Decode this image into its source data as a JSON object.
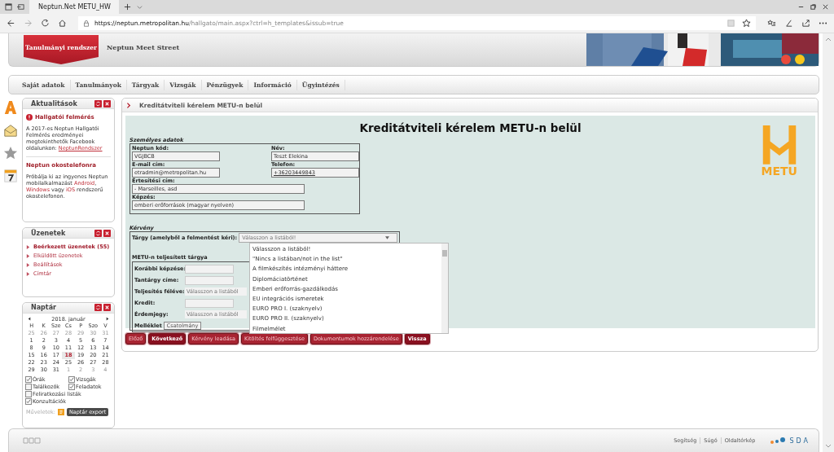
{
  "browser": {
    "tab_title": "Neptun.Net METU_HW",
    "url_host": "https://neptun.metropolitan.hu",
    "url_path": "/hallgato/main.aspx?ctrl=h_templates&issub=true"
  },
  "header": {
    "system_tab": "Tanulmányi rendszer",
    "site_title": "Neptun Meet Street"
  },
  "menu": [
    {
      "label": "Saját adatok"
    },
    {
      "label": "Tanulmányok"
    },
    {
      "label": "Tárgyak"
    },
    {
      "label": "Vizsgák"
    },
    {
      "label": "Pénzügyek"
    },
    {
      "label": "Információ"
    },
    {
      "label": "Ügyintézés"
    }
  ],
  "news": {
    "title": "Aktualitások",
    "items": [
      {
        "title": "Hallgatói felmérés",
        "alert": true,
        "parts": [
          {
            "kind": "text",
            "text": "A 2017-es Neptun Hallgatói Felmérés eredményei megtekinthetők Facebook oldalunkon: "
          },
          {
            "kind": "link",
            "text": "NeptunRendszer"
          }
        ]
      },
      {
        "title": "Neptun okostelefonra",
        "alert": false,
        "parts": [
          {
            "kind": "text",
            "text": "Próbálja ki az ingyenes Neptun mobilalkalmazást "
          },
          {
            "kind": "link",
            "text": "Android"
          },
          {
            "kind": "text",
            "text": ", "
          },
          {
            "kind": "link",
            "text": "Windows"
          },
          {
            "kind": "text",
            "text": " vagy "
          },
          {
            "kind": "link",
            "text": "iOS"
          },
          {
            "kind": "text",
            "text": " rendszerű okostelefonon."
          }
        ]
      }
    ]
  },
  "messages": {
    "title": "Üzenetek",
    "items": [
      {
        "label": "Beérkezett üzenetek (55)",
        "unread": true
      },
      {
        "label": "Elküldött üzenetek",
        "unread": false
      },
      {
        "label": "Beállítások",
        "unread": false
      },
      {
        "label": "Címtár",
        "unread": false
      }
    ]
  },
  "calendar": {
    "title": "Naptár",
    "month": "2018. január",
    "weekdays": [
      "H",
      "K",
      "Sze",
      "Cs",
      "P",
      "Szo",
      "V"
    ],
    "weeks": [
      [
        {
          "day": "25",
          "other_month": true,
          "today": false
        },
        {
          "day": "26",
          "other_month": true,
          "today": false
        },
        {
          "day": "27",
          "other_month": true,
          "today": false
        },
        {
          "day": "28",
          "other_month": true,
          "today": false
        },
        {
          "day": "29",
          "other_month": true,
          "today": false
        },
        {
          "day": "30",
          "other_month": true,
          "today": false
        },
        {
          "day": "31",
          "other_month": true,
          "today": false
        }
      ],
      [
        {
          "day": "1",
          "other_month": false,
          "today": false
        },
        {
          "day": "2",
          "other_month": false,
          "today": false
        },
        {
          "day": "3",
          "other_month": false,
          "today": false
        },
        {
          "day": "4",
          "other_month": false,
          "today": false
        },
        {
          "day": "5",
          "other_month": false,
          "today": false
        },
        {
          "day": "6",
          "other_month": false,
          "today": false
        },
        {
          "day": "7",
          "other_month": false,
          "today": false
        }
      ],
      [
        {
          "day": "8",
          "other_month": false,
          "today": false
        },
        {
          "day": "9",
          "other_month": false,
          "today": false
        },
        {
          "day": "10",
          "other_month": false,
          "today": false
        },
        {
          "day": "11",
          "other_month": false,
          "today": false
        },
        {
          "day": "12",
          "other_month": false,
          "today": false
        },
        {
          "day": "13",
          "other_month": false,
          "today": false
        },
        {
          "day": "14",
          "other_month": false,
          "today": false
        }
      ],
      [
        {
          "day": "15",
          "other_month": false,
          "today": false
        },
        {
          "day": "16",
          "other_month": false,
          "today": false
        },
        {
          "day": "17",
          "other_month": false,
          "today": false
        },
        {
          "day": "18",
          "other_month": false,
          "today": true
        },
        {
          "day": "19",
          "other_month": false,
          "today": false
        },
        {
          "day": "20",
          "other_month": false,
          "today": false
        },
        {
          "day": "21",
          "other_month": false,
          "today": false
        }
      ],
      [
        {
          "day": "22",
          "other_month": false,
          "today": false
        },
        {
          "day": "23",
          "other_month": false,
          "today": false
        },
        {
          "day": "24",
          "other_month": false,
          "today": false
        },
        {
          "day": "25",
          "other_month": false,
          "today": false
        },
        {
          "day": "26",
          "other_month": false,
          "today": false
        },
        {
          "day": "27",
          "other_month": false,
          "today": false
        },
        {
          "day": "28",
          "other_month": false,
          "today": false
        }
      ],
      [
        {
          "day": "29",
          "other_month": false,
          "today": false
        },
        {
          "day": "30",
          "other_month": false,
          "today": false
        },
        {
          "day": "31",
          "other_month": false,
          "today": false
        },
        {
          "day": "1",
          "other_month": true,
          "today": false
        },
        {
          "day": "2",
          "other_month": true,
          "today": false
        },
        {
          "day": "3",
          "other_month": true,
          "today": false
        },
        {
          "day": "4",
          "other_month": true,
          "today": false
        }
      ]
    ],
    "filters": [
      {
        "label": "Órák",
        "checked": true
      },
      {
        "label": "Vizsgák",
        "checked": true
      },
      {
        "label": "Találkozók",
        "checked": false
      },
      {
        "label": "Feladatok",
        "checked": true
      },
      {
        "label": "Feliratkozási listák",
        "checked": false
      },
      {
        "label": "Konzultációk",
        "checked": true
      }
    ],
    "actions_label": "Műveletek:",
    "export_button": "Naptár export"
  },
  "main": {
    "breadcrumb": "Kreditátviteli kérelem METU-n belül",
    "heading": "Kreditátviteli kérelem METU-n belül",
    "logo_text": "METU",
    "personal": {
      "title": "Személyes adatok",
      "fields": [
        {
          "label": "Neptun kód:",
          "value": "VGJBCB",
          "kind": "short"
        },
        {
          "label": "Név:",
          "value": "Teszt Elekina",
          "kind": "short"
        },
        {
          "label": "E-mail cím:",
          "value": "etradmin@metropolitan.hu",
          "kind": "short"
        },
        {
          "label": "Telefon:",
          "value": "+36203449843",
          "kind": "link"
        },
        {
          "label": "Értesítési cím:",
          "value": "- Marseilles, asd",
          "kind": "wide"
        },
        {
          "label": "Képzés:",
          "value": "emberi erőforrások (magyar nyelven)",
          "kind": "wide"
        }
      ]
    },
    "request": {
      "title": "Kérvény",
      "subject_label": "Tárgy (amelyből a felmentést kéri):",
      "subject_value": "Válasszon a listából!",
      "expanded": true,
      "options": [
        {
          "label": "Válasszon a listából!"
        },
        {
          "label": "\"Nincs a listában/not in the list\""
        },
        {
          "label": "A filmkészítés intézményi háttere"
        },
        {
          "label": "Diplomáciatörténet"
        },
        {
          "label": "Emberi erőforrás-gazdálkodás"
        },
        {
          "label": "EU integrációs ismeretek"
        },
        {
          "label": "EURO PRO I. (szaknyelv)"
        },
        {
          "label": "EURO PRO II. (szaknyelv)"
        },
        {
          "label": "Filmelmélet"
        }
      ],
      "completed_title": "METU-n teljesített tárgya",
      "rows": [
        {
          "label": "Korábbi képzése:",
          "kind": "input"
        },
        {
          "label": "Tantárgy címe:",
          "kind": "input"
        },
        {
          "label": "Teljesítés féléve:",
          "kind": "select",
          "placeholder": "Válasszon a listából"
        },
        {
          "label": "Kredit:",
          "kind": "input"
        },
        {
          "label": "Érdemjegy:",
          "kind": "select",
          "placeholder": "Válasszon a listából"
        },
        {
          "label": "Melléklet",
          "kind": "file",
          "button": "Csatolmány"
        }
      ]
    },
    "buttons": [
      {
        "label": "Előző",
        "emphasis": false
      },
      {
        "label": "Következő",
        "emphasis": true
      },
      {
        "label": "Kérvény leadása",
        "emphasis": false
      },
      {
        "label": "Kitöltés felfüggesztése",
        "emphasis": false
      },
      {
        "label": "Dokumentumok hozzárendelése",
        "emphasis": false
      },
      {
        "label": "Vissza",
        "emphasis": true
      }
    ]
  },
  "footer": {
    "links": [
      "Segítség",
      "Súgó",
      "Oldaltérkép"
    ],
    "logo": "SDA"
  }
}
